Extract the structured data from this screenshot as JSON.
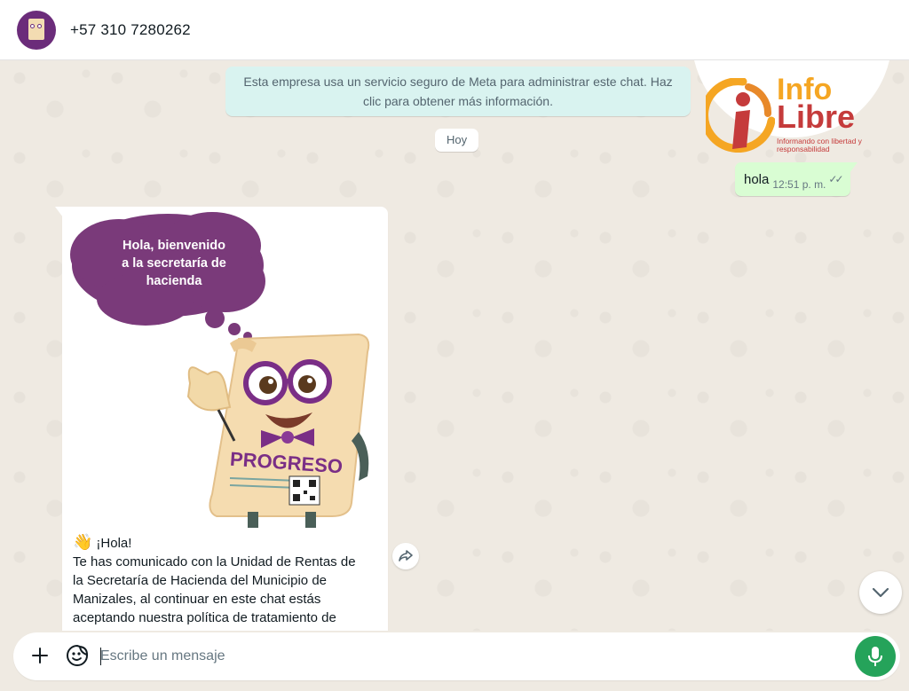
{
  "header": {
    "contact_name": "+57 310 7280262",
    "avatar_icon": "progreso-mascot-avatar"
  },
  "system_notice": {
    "text": "Esta empresa usa un servicio seguro de Meta para administrar este chat. Haz clic para obtener más información."
  },
  "logo": {
    "line1": "Info",
    "line2": "Libre",
    "tagline": "Informando con libertad y responsabilidad",
    "colors": {
      "orange": "#f5a623",
      "red": "#c53b3b"
    }
  },
  "date_divider": "Hoy",
  "outgoing": {
    "text": "hola",
    "time": "12:51 p. m.",
    "status_icon": "double-check-icon"
  },
  "incoming": {
    "image": {
      "cloud_lines": [
        "Hola, bienvenido",
        "a la secretaría de",
        "hacienda"
      ],
      "scroll_label": "PROGRESO"
    },
    "emoji": "👋",
    "greeting": "¡Hola!",
    "lines": [
      "Te has comunicado con la Unidad de Rentas de",
      "la Secretaría de Hacienda del Municipio de",
      "Manizales, al continuar en este chat estás",
      "aceptando nuestra política de tratamiento de"
    ]
  },
  "composer": {
    "placeholder": "Escribe un mensaje",
    "attach_icon": "plus-icon",
    "sticker_icon": "sticker-icon",
    "mic_icon": "microphone-icon"
  },
  "colors": {
    "chat_bg": "#efeae2",
    "outgoing_bubble": "#d9fdd3",
    "system_bubble": "#d9f3f0",
    "mic_green": "#25a35a",
    "brand_purple": "#6b2c7a"
  }
}
